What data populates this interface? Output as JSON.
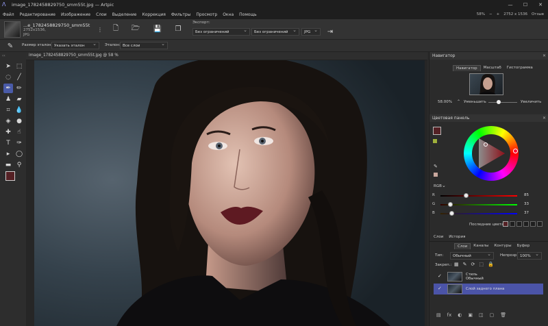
{
  "window": {
    "title": "image_1782458829750_smm55t.jpg — Artpic",
    "minimize": "—",
    "maximize": "☐",
    "close": "✕"
  },
  "menu": {
    "items": [
      "Файл",
      "Редактирование",
      "Изображение",
      "Слои",
      "Выделение",
      "Коррекция",
      "Фильтры",
      "Просмотр",
      "Окна",
      "Помощь"
    ],
    "zoom": "58%",
    "dims": "2752 x 1536",
    "feedback": "Отзыв"
  },
  "document": {
    "name": "...e_1782458829750_smm55t",
    "size": "2752x1536,",
    "format": "JPG",
    "export_label": "Экспорт:",
    "export_size1": "Без ограничений",
    "export_size2": "Без ограничений",
    "export_format": "JPG"
  },
  "options": {
    "sample_size_label": "Размер эталона:",
    "sample_size_value": "Указать эталон",
    "sample_label": "Эталон:",
    "sample_value": "Все слои"
  },
  "canvas": {
    "tab_title": "image_1782458829750_smm55t.jpg @ 58 %"
  },
  "navigator": {
    "header": "Навигатор",
    "tabs": [
      "Навигатор",
      "Масштаб",
      "Гистограмма"
    ],
    "zoom_value": "58.00%",
    "zoom_out": "Уменьшить",
    "zoom_in": "Увеличить",
    "zoom_level": 0.35
  },
  "color": {
    "header": "Цветовая панель",
    "mode": "RGB",
    "channels": [
      {
        "label": "R",
        "value": "85"
      },
      {
        "label": "G",
        "value": "33"
      },
      {
        "label": "B",
        "value": "37"
      }
    ],
    "recent_label": "Последние цвета:",
    "fg_color": "#552125",
    "accent": "#4b54a8"
  },
  "layers": {
    "tabs_top": [
      "Слои",
      "История"
    ],
    "tabs": [
      "Слои",
      "Каналы",
      "Контуры",
      "Буфер"
    ],
    "type_label": "Тип:",
    "type_value": "Обычный",
    "opacity_label": "Непрозр.:",
    "opacity_value": "100%",
    "lock_label": "Закреп.:",
    "items": [
      {
        "name": "Стиль",
        "mode": "Обычный",
        "checked": "✓"
      },
      {
        "name": "Слой заднего плана",
        "mode": "",
        "checked": "✓"
      }
    ]
  },
  "tools": [
    "arrow-icon",
    "marquee-icon",
    "lasso-icon",
    "brush-icon",
    "eyedropper-icon",
    "pencil-icon",
    "stamp-icon",
    "eraser-icon",
    "crop-icon",
    "drop-icon",
    "bucket-icon",
    "dodge-icon",
    "heal-icon",
    "smudge-icon",
    "text-icon",
    "pen-icon",
    "path-select-icon",
    "ellipse-icon",
    "hand-icon",
    "zoom-icon"
  ]
}
